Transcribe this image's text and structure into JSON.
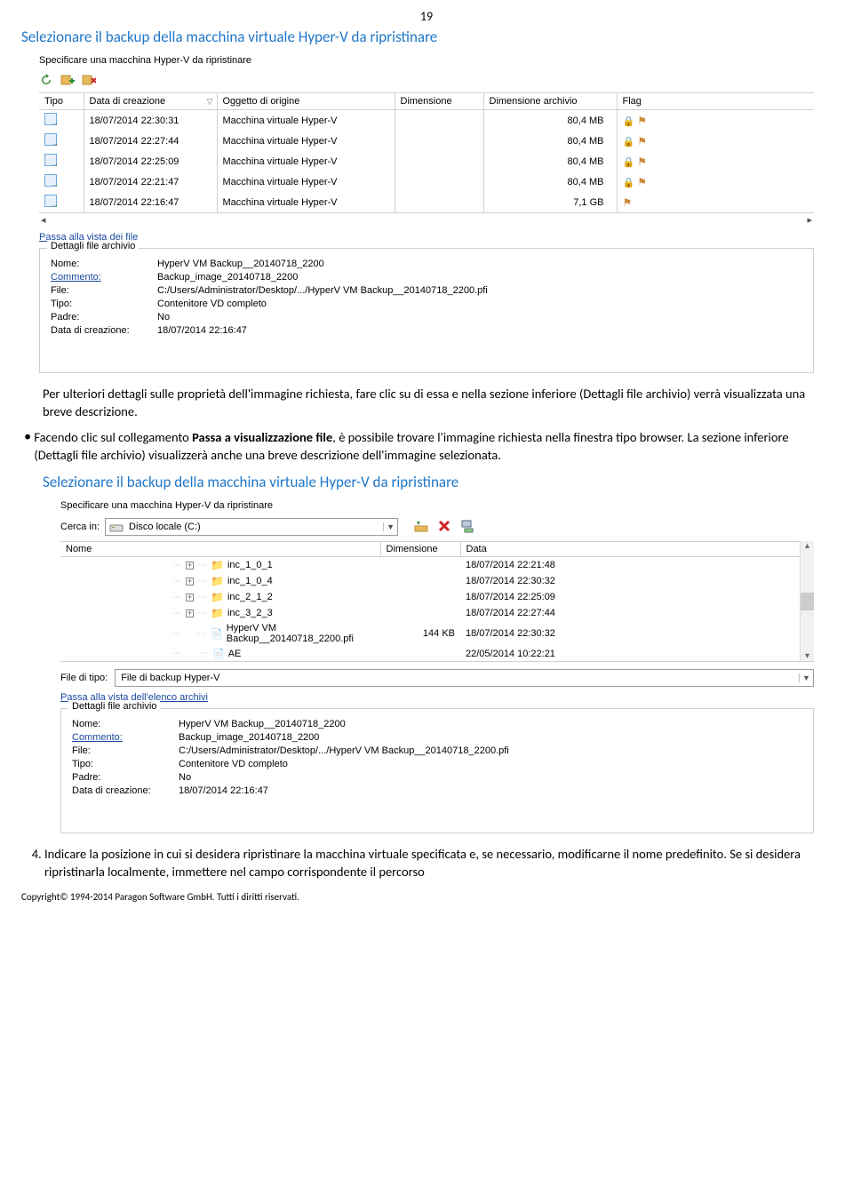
{
  "page_number": "19",
  "heading1": "Selezionare il backup della macchina virtuale Hyper-V da ripristinare",
  "screenshot1": {
    "spec_label": "Specificare una macchina Hyper-V da ripristinare",
    "columns": {
      "c1": "Tipo",
      "c2": "Data di creazione",
      "c3": "Oggetto di origine",
      "c4": "Dimensione",
      "c5": "Dimensione archivio",
      "c6": "Flag"
    },
    "rows": [
      {
        "date": "18/07/2014 22:30:31",
        "origin": "Macchina virtuale Hyper-V",
        "arch": "80,4 MB"
      },
      {
        "date": "18/07/2014 22:27:44",
        "origin": "Macchina virtuale Hyper-V",
        "arch": "80,4 MB"
      },
      {
        "date": "18/07/2014 22:25:09",
        "origin": "Macchina virtuale Hyper-V",
        "arch": "80,4 MB"
      },
      {
        "date": "18/07/2014 22:21:47",
        "origin": "Macchina virtuale Hyper-V",
        "arch": "80,4 MB"
      },
      {
        "date": "18/07/2014 22:16:47",
        "origin": "Macchina virtuale Hyper-V",
        "arch": "7,1 GB"
      }
    ],
    "link_fileview": "Passa alla vista dei file",
    "fieldset_title": "Dettagli file archivio",
    "details": {
      "name_lab": "Nome:",
      "name_val": "HyperV VM Backup__20140718_2200",
      "comment_lab": "Commento:",
      "comment_val": "Backup_image_20140718_2200",
      "file_lab": "File:",
      "file_val": "C:/Users/Administrator/Desktop/.../HyperV VM Backup__20140718_2200.pfi",
      "type_lab": "Tipo:",
      "type_val": "Contenitore VD completo",
      "parent_lab": "Padre:",
      "parent_val": "No",
      "date_lab": "Data di creazione:",
      "date_val": "18/07/2014 22:16:47"
    }
  },
  "para1": "Per ulteriori dettagli sulle proprietà dell'immagine richiesta, fare clic su di essa e nella sezione inferiore (Dettagli file archivio) verrà visualizzata una breve descrizione.",
  "bullet1_a": "Facendo clic sul collegamento ",
  "bullet1_bold": "Passa a visualizzazione file",
  "bullet1_b": ", è possibile trovare l'immagine richiesta nella finestra tipo browser. La sezione inferiore (Dettagli file archivio) visualizzerà anche una breve descrizione dell'immagine selezionata.",
  "screenshot2": {
    "spec_label": "Specificare una macchina Hyper-V da ripristinare",
    "search_lab": "Cerca in:",
    "search_val": "Disco locale (C:)",
    "columns": {
      "c1": "Nome",
      "c2": "Dimensione",
      "c3": "Data"
    },
    "rows": [
      {
        "exp": "+",
        "icon": "folder",
        "name": "inc_1_0_1",
        "size": "",
        "date": "18/07/2014 22:21:48"
      },
      {
        "exp": "+",
        "icon": "folder",
        "name": "inc_1_0_4",
        "size": "",
        "date": "18/07/2014 22:30:32"
      },
      {
        "exp": "+",
        "icon": "folder",
        "name": "inc_2_1_2",
        "size": "",
        "date": "18/07/2014 22:25:09"
      },
      {
        "exp": "+",
        "icon": "folder",
        "name": "inc_3_2_3",
        "size": "",
        "date": "18/07/2014 22:27:44"
      },
      {
        "exp": "",
        "icon": "file",
        "name": "HyperV VM Backup__20140718_2200.pfi",
        "size": "144 KB",
        "date": "18/07/2014 22:30:32"
      },
      {
        "exp": "",
        "icon": "file",
        "name": "AE",
        "size": "",
        "date": "22/05/2014 10:22:21"
      }
    ],
    "filetype_lab": "File di tipo:",
    "filetype_val": "File di backup Hyper-V",
    "link_archview": "Passa alla vista dell'elenco archivi",
    "fieldset_title": "Dettagli file archivio",
    "details": {
      "name_lab": "Nome:",
      "name_val": "HyperV VM Backup__20140718_2200",
      "comment_lab": "Commento:",
      "comment_val": "Backup_image_20140718_2200",
      "file_lab": "File:",
      "file_val": "C:/Users/Administrator/Desktop/.../HyperV VM Backup__20140718_2200.pfi",
      "type_lab": "Tipo:",
      "type_val": "Contenitore VD completo",
      "parent_lab": "Padre:",
      "parent_val": "No",
      "date_lab": "Data di creazione:",
      "date_val": "18/07/2014 22:16:47"
    }
  },
  "num4": "Indicare la posizione in cui si desidera ripristinare la macchina virtuale specificata e, se necessario, modificarne il nome predefinito. Se si desidera ripristinarla localmente, immettere nel campo corrispondente il percorso",
  "footer": "Copyright© 1994-2014 Paragon Software GmbH. Tutti i diritti riservati."
}
